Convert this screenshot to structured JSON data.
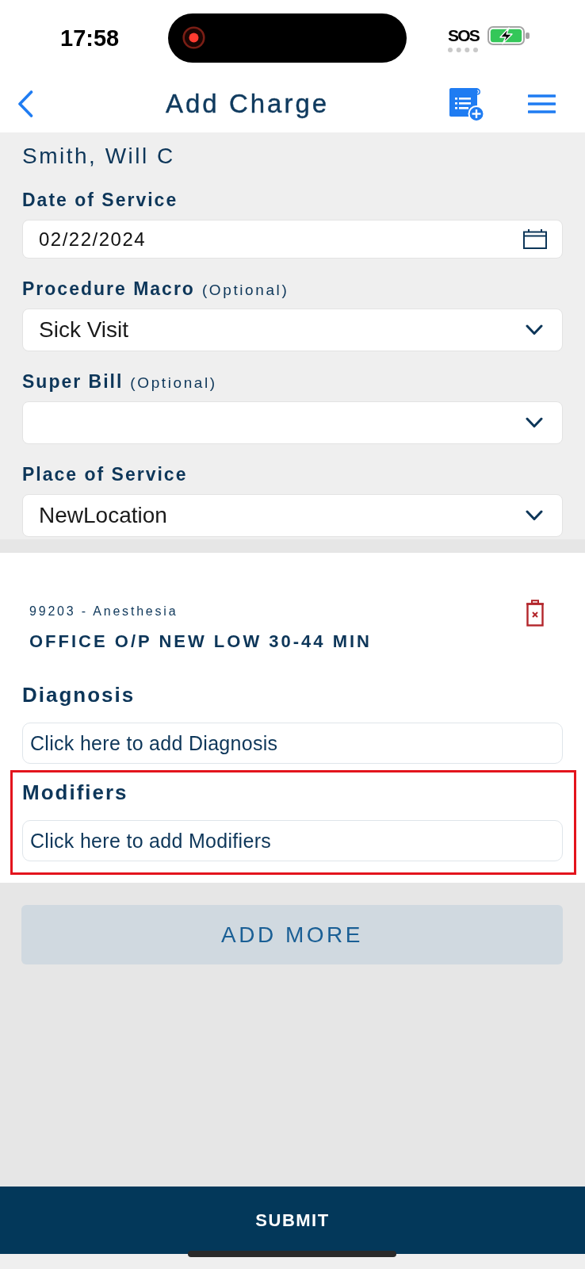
{
  "status_bar": {
    "time": "17:58",
    "network": "SOS"
  },
  "nav": {
    "title": "Add Charge"
  },
  "patient": {
    "name": "Smith, Will C"
  },
  "fields": [
    {
      "label": "Date of Service",
      "kind": "date",
      "value": "02/22/2024"
    },
    {
      "label": "Procedure Macro",
      "note": "(Optional)",
      "kind": "select",
      "value": "Sick Visit"
    },
    {
      "label": "Super Bill",
      "note": "(Optional)",
      "kind": "select"
    },
    {
      "label": "Place of Service",
      "kind": "select",
      "value": "NewLocation"
    }
  ],
  "charge": {
    "code": "99203 - Anesthesia",
    "description": "OFFICE O/P NEW LOW 30-44 MIN",
    "sections": [
      {
        "heading": "Diagnosis",
        "placeholder": "Click here to add Diagnosis",
        "highlighted": false
      },
      {
        "heading": "Modifiers",
        "placeholder": "Click here to add Modifiers",
        "highlighted": true
      }
    ]
  },
  "actions": {
    "add_more": "ADD MORE",
    "submit": "SUBMIT"
  }
}
